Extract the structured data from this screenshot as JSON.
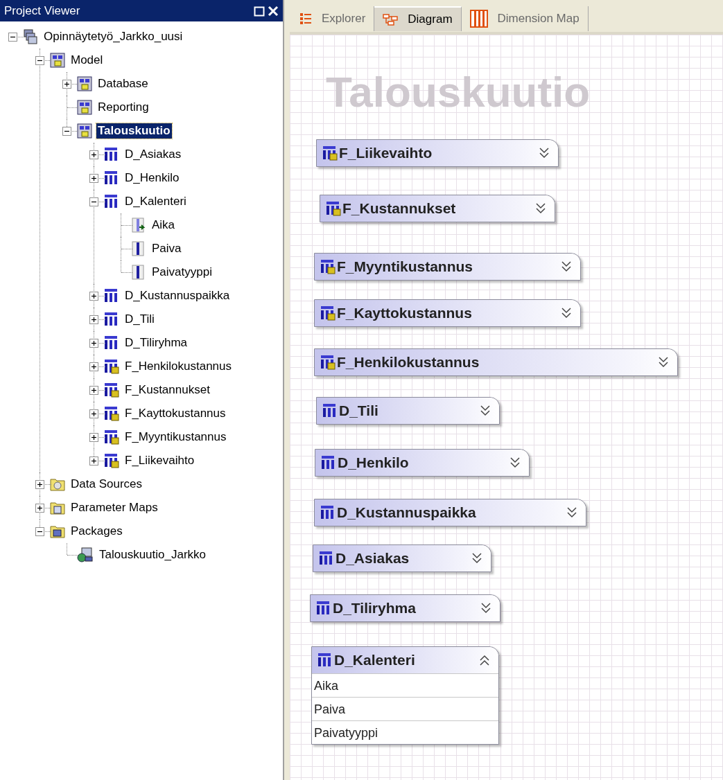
{
  "project_viewer": {
    "title": "Project Viewer",
    "tree": [
      {
        "label": "Opinnäytetyö_Jarkko_uusi",
        "kind": "project",
        "expanded": true,
        "selected": false,
        "children": [
          {
            "label": "Model",
            "kind": "model",
            "expanded": true,
            "selected": false,
            "children": [
              {
                "label": "Database",
                "kind": "model",
                "expanded": false,
                "selected": false
              },
              {
                "label": "Reporting",
                "kind": "model",
                "selected": false
              },
              {
                "label": "Talouskuutio",
                "kind": "model",
                "expanded": true,
                "selected": true,
                "children": [
                  {
                    "label": "D_Asiakas",
                    "kind": "dimension",
                    "expanded": false,
                    "selected": false
                  },
                  {
                    "label": "D_Henkilo",
                    "kind": "dimension",
                    "expanded": false,
                    "selected": false
                  },
                  {
                    "label": "D_Kalenteri",
                    "kind": "dimension",
                    "expanded": true,
                    "selected": false,
                    "children": [
                      {
                        "label": "Aika",
                        "kind": "key_attribute",
                        "selected": false
                      },
                      {
                        "label": "Paiva",
                        "kind": "attribute",
                        "selected": false
                      },
                      {
                        "label": "Paivatyyppi",
                        "kind": "attribute",
                        "selected": false
                      }
                    ]
                  },
                  {
                    "label": "D_Kustannuspaikka",
                    "kind": "dimension",
                    "expanded": false,
                    "selected": false
                  },
                  {
                    "label": "D_Tili",
                    "kind": "dimension",
                    "expanded": false,
                    "selected": false
                  },
                  {
                    "label": "D_Tiliryhma",
                    "kind": "dimension",
                    "expanded": false,
                    "selected": false
                  },
                  {
                    "label": "F_Henkilokustannus",
                    "kind": "fact",
                    "expanded": false,
                    "selected": false
                  },
                  {
                    "label": "F_Kustannukset",
                    "kind": "fact",
                    "expanded": false,
                    "selected": false
                  },
                  {
                    "label": "F_Kayttokustannus",
                    "kind": "fact",
                    "expanded": false,
                    "selected": false
                  },
                  {
                    "label": "F_Myyntikustannus",
                    "kind": "fact",
                    "expanded": false,
                    "selected": false
                  },
                  {
                    "label": "F_Liikevaihto",
                    "kind": "fact",
                    "expanded": false,
                    "selected": false
                  }
                ]
              }
            ]
          },
          {
            "label": "Data Sources",
            "kind": "datasource_folder",
            "expanded": false,
            "selected": false
          },
          {
            "label": "Parameter Maps",
            "kind": "parameter_folder",
            "expanded": false,
            "selected": false
          },
          {
            "label": "Packages",
            "kind": "package_folder",
            "expanded": true,
            "selected": false,
            "children": [
              {
                "label": "Talouskuutio_Jarkko",
                "kind": "package",
                "selected": false
              }
            ]
          }
        ]
      }
    ]
  },
  "tabs": [
    {
      "label": "Explorer",
      "kind": "explorer",
      "selected": false
    },
    {
      "label": "Diagram",
      "kind": "diagram",
      "selected": true
    },
    {
      "label": "Dimension Map",
      "kind": "dimension_map",
      "selected": false
    }
  ],
  "diagram": {
    "title": "Talouskuutio",
    "nodes": [
      {
        "label": "F_Liikevaihto",
        "kind": "fact",
        "expanded": false
      },
      {
        "label": "F_Kustannukset",
        "kind": "fact",
        "expanded": false
      },
      {
        "label": "F_Myyntikustannus",
        "kind": "fact",
        "expanded": false
      },
      {
        "label": "F_Kayttokustannus",
        "kind": "fact",
        "expanded": false
      },
      {
        "label": "F_Henkilokustannus",
        "kind": "fact",
        "expanded": false
      },
      {
        "label": "D_Tili",
        "kind": "dimension",
        "expanded": false
      },
      {
        "label": "D_Henkilo",
        "kind": "dimension",
        "expanded": false
      },
      {
        "label": "D_Kustannuspaikka",
        "kind": "dimension",
        "expanded": false
      },
      {
        "label": "D_Asiakas",
        "kind": "dimension",
        "expanded": false
      },
      {
        "label": "D_Tiliryhma",
        "kind": "dimension",
        "expanded": false
      },
      {
        "label": "D_Kalenteri",
        "kind": "dimension",
        "expanded": true,
        "items": [
          "Aika",
          "Paiva",
          "Paivatyyppi"
        ]
      }
    ]
  }
}
